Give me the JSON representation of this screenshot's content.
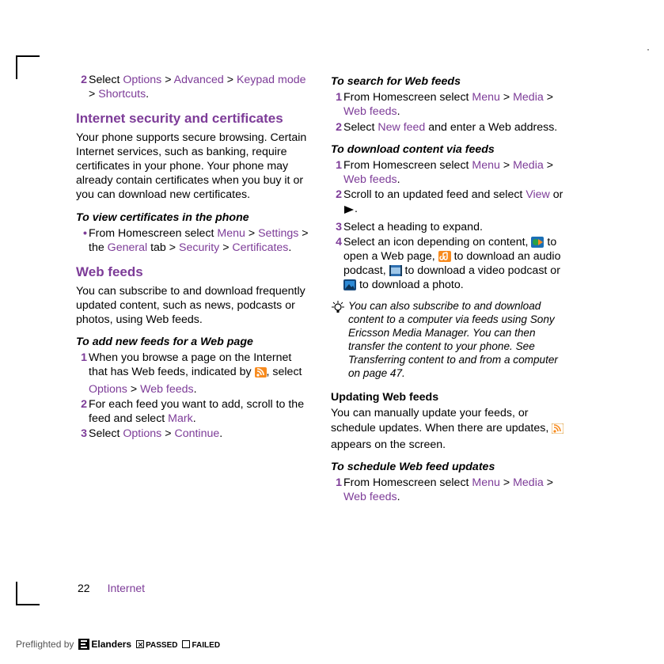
{
  "left": {
    "step_continued": {
      "num": "2",
      "text_a": "Select ",
      "opt": "Options",
      "gt1": " > ",
      "adv": "Advanced",
      "gt2": " > ",
      "keypad": "Keypad mode",
      "gt3": " > ",
      "shortcuts": "Shortcuts",
      "dot": "."
    },
    "h_sec": "Internet security and certificates",
    "sec_body": "Your phone supports secure browsing. Certain Internet services, such as banking, require certificates in your phone. Your phone may already contain certificates when you buy it or you can download new certificates.",
    "sub_view": "To view certificates in the phone",
    "view_item": {
      "a": "From Homescreen select ",
      "menu": "Menu",
      "gt1": " > ",
      "settings": "Settings",
      "gt2": " > the ",
      "general": "General",
      "tab": " tab > ",
      "security": "Security",
      "gt3": " > ",
      "certs": "Certificates",
      "dot": "."
    },
    "h_feeds": "Web feeds",
    "feeds_body": "You can subscribe to and download frequently updated content, such as news, podcasts or photos, using Web feeds.",
    "sub_add": "To add new feeds for a Web page",
    "add1": {
      "num": "1",
      "a": "When you browse a page on the Internet that has Web feeds, indicated by ",
      "b": ", select ",
      "opt": "Options",
      "gt": " > ",
      "wf": "Web feeds",
      "dot": "."
    },
    "add2": {
      "num": "2",
      "a": "For each feed you want to add, scroll to the feed and select ",
      "mark": "Mark",
      "dot": "."
    },
    "add3": {
      "num": "3",
      "a": "Select ",
      "opt": "Options",
      "gt": " > ",
      "cont": "Continue",
      "dot": "."
    }
  },
  "right": {
    "sub_search": "To search for Web feeds",
    "s1": {
      "num": "1",
      "a": "From Homescreen select ",
      "menu": "Menu",
      "gt1": " > ",
      "media": "Media",
      "gt2": " > ",
      "wf": "Web feeds",
      "dot": "."
    },
    "s2": {
      "num": "2",
      "a": "Select ",
      "nf": "New feed",
      "b": " and enter a Web address."
    },
    "sub_dl": "To download content via feeds",
    "d1": {
      "num": "1",
      "a": "From Homescreen select ",
      "menu": "Menu",
      "gt1": " > ",
      "media": "Media",
      "gt2": " > ",
      "wf": "Web feeds",
      "dot": "."
    },
    "d2": {
      "num": "2",
      "a": "Scroll to an updated feed and select ",
      "view": "View",
      "or": " or ",
      "dot": "."
    },
    "d3": {
      "num": "3",
      "a": "Select a heading to expand."
    },
    "d4": {
      "num": "4",
      "a": "Select an icon depending on content, ",
      "b": " to open a Web page, ",
      "c": " to download an audio podcast, ",
      "d": " to download a video podcast or ",
      "e": " to download a photo."
    },
    "tip": "You can also subscribe to and download content to a computer via feeds using Sony Ericsson Media Manager. You can then transfer the content to your phone. See Transferring content to and from a computer on page 47.",
    "h_upd": "Updating Web feeds",
    "upd_body_a": "You can manually update your feeds, or schedule updates. When there are updates, ",
    "upd_body_b": " appears on the screen.",
    "sub_sched": "To schedule Web feed updates",
    "sch1": {
      "num": "1",
      "a": "From Homescreen select ",
      "menu": "Menu",
      "gt1": " > ",
      "media": "Media",
      "gt2": " > ",
      "wf": "Web feeds",
      "dot": "."
    }
  },
  "footer": {
    "page": "22",
    "section": "Internet"
  },
  "preflight": {
    "pre": "Preflighted by",
    "brand": "Elanders",
    "passed": "PASSED",
    "failed": "FAILED"
  },
  "icons": {
    "rss_orange": "rss-feed-icon",
    "play": "play-icon",
    "globe": "web-page-icon",
    "audio": "audio-podcast-icon",
    "video": "video-podcast-icon",
    "photo": "photo-icon",
    "rss_small": "rss-update-icon",
    "tip": "tip-lightbulb-icon"
  }
}
